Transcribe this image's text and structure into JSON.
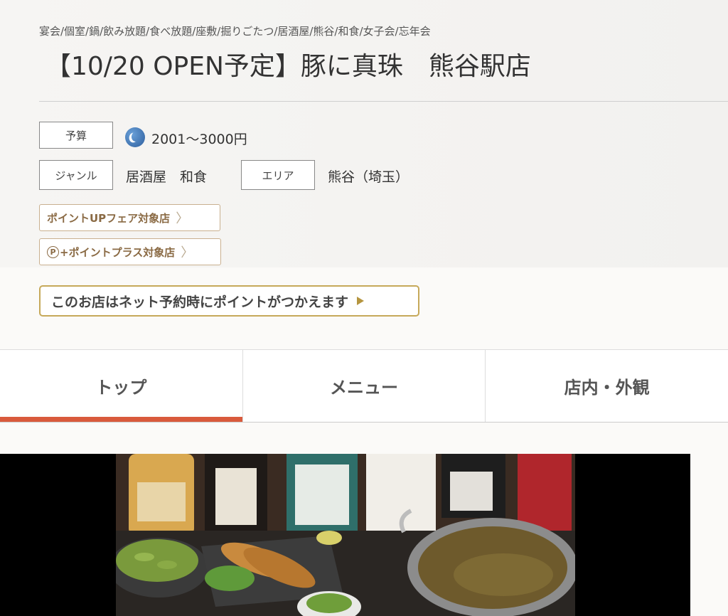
{
  "restaurant": {
    "tags": "宴会/個室/鍋/飲み放題/食べ放題/座敷/掘りごたつ/居酒屋/熊谷/和食/女子会/忘年会",
    "title": "【10/20 OPEN予定】豚に真珠　熊谷駅店"
  },
  "info": {
    "budget_label": "予算",
    "budget_icon": "moon-dinner-icon",
    "budget_value": "2001～3000円",
    "genre_label": "ジャンル",
    "genre_value": "居酒屋　和食",
    "area_label": "エリア",
    "area_value": "熊谷（埼玉）"
  },
  "badges": {
    "fair": "ポイントUPフェア対象店",
    "pplus_mark": "P",
    "pplus_text": "+ポイントプラス対象店",
    "chevron": "〉"
  },
  "point_notice": "このお店はネット予約時にポイントがつかえます",
  "tabs": [
    {
      "label": "トップ",
      "active": true
    },
    {
      "label": "メニュー",
      "active": false
    },
    {
      "label": "店内・外観",
      "active": false
    }
  ],
  "colors": {
    "accent_tab": "#d95a3c",
    "badge_text": "#8a6a44",
    "point_border": "#c6a95a"
  }
}
